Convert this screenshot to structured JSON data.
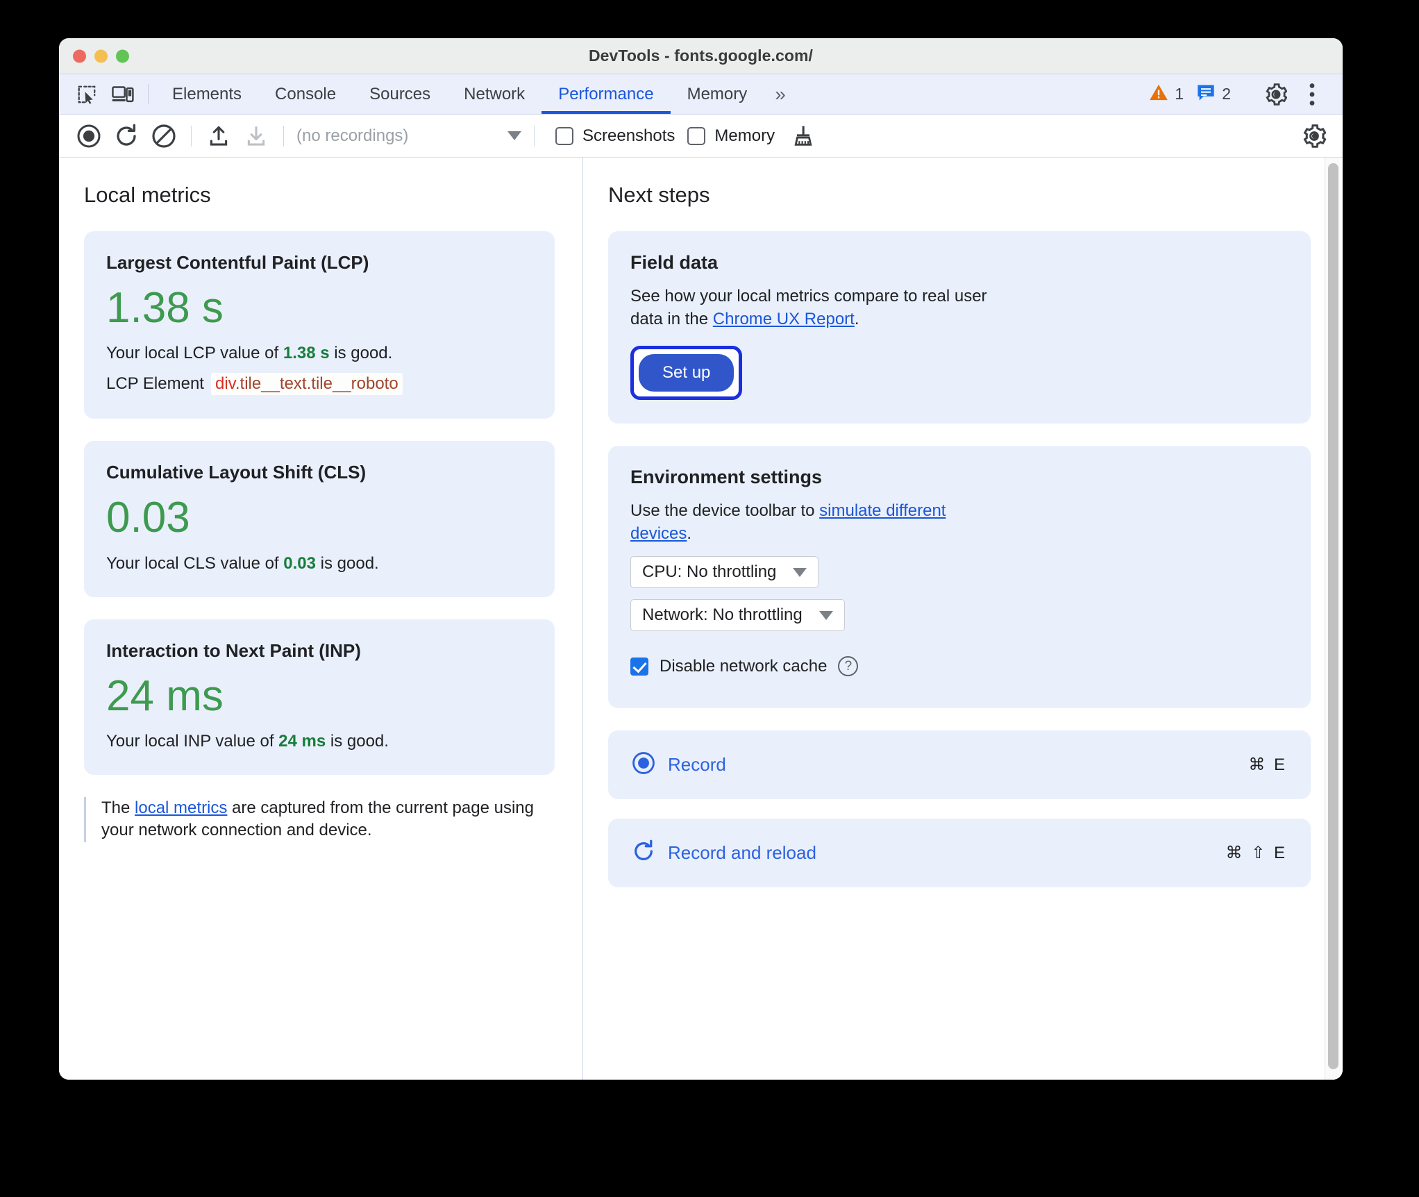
{
  "window": {
    "title": "DevTools - fonts.google.com/",
    "traffic_lights": [
      "close",
      "minimize",
      "maximize"
    ]
  },
  "tabbar": {
    "icons": [
      {
        "name": "inspect-element-icon"
      },
      {
        "name": "device-toolbar-icon"
      }
    ],
    "tabs": [
      {
        "label": "Elements",
        "active": false
      },
      {
        "label": "Console",
        "active": false
      },
      {
        "label": "Sources",
        "active": false
      },
      {
        "label": "Network",
        "active": false
      },
      {
        "label": "Performance",
        "active": true
      },
      {
        "label": "Memory",
        "active": false
      }
    ],
    "more_label": "»",
    "warning_count": "1",
    "info_count": "2",
    "settings_icon": "gear-icon",
    "more_options_icon": "kebab-menu-icon"
  },
  "toolbar": {
    "buttons": [
      {
        "name": "record-button",
        "icon": "record-circle-icon"
      },
      {
        "name": "record-and-reload-button",
        "icon": "reload-icon"
      },
      {
        "name": "clear-button",
        "icon": "no-entry-icon"
      },
      {
        "name": "load-profile-button",
        "icon": "upload-arrow-icon"
      },
      {
        "name": "save-profile-button",
        "icon": "download-arrow-icon"
      }
    ],
    "recordings_placeholder": "(no recordings)",
    "screenshots_label": "Screenshots",
    "screenshots_checked": false,
    "memory_label": "Memory",
    "memory_checked": false,
    "garbage_collect_icon": "broom-icon",
    "capture_settings_icon": "gear-icon"
  },
  "left": {
    "title": "Local metrics",
    "metrics": [
      {
        "name": "Largest Contentful Paint (LCP)",
        "value": "1.38 s",
        "desc_prefix": "Your local LCP value of ",
        "desc_value": "1.38 s",
        "desc_suffix": " is good.",
        "element_label": "LCP Element",
        "element_tag": "div",
        "element_classes": ".tile__text.tile__roboto"
      },
      {
        "name": "Cumulative Layout Shift (CLS)",
        "value": "0.03",
        "desc_prefix": "Your local CLS value of ",
        "desc_value": "0.03",
        "desc_suffix": " is good."
      },
      {
        "name": "Interaction to Next Paint (INP)",
        "value": "24 ms",
        "desc_prefix": "Your local INP value of ",
        "desc_value": "24 ms",
        "desc_suffix": " is good."
      }
    ],
    "note_prefix": "The ",
    "note_link": "local metrics",
    "note_suffix": " are captured from the current page using your network connection and device."
  },
  "right": {
    "title": "Next steps",
    "field_data": {
      "heading": "Field data",
      "body_prefix": "See how your local metrics compare to real user data in the ",
      "body_link": "Chrome UX Report",
      "body_suffix": ".",
      "setup_label": "Set up"
    },
    "environment": {
      "heading": "Environment settings",
      "body_prefix": "Use the device toolbar to ",
      "body_link": "simulate different devices",
      "body_suffix": ".",
      "cpu_throttling": "CPU: No throttling",
      "network_throttling": "Network: No throttling",
      "cache_label": "Disable network cache",
      "cache_checked": true,
      "help_glyph": "?"
    },
    "actions": [
      {
        "label": "Record",
        "shortcut": "⌘ E",
        "icon": "record-circle-icon"
      },
      {
        "label": "Record and reload",
        "shortcut": "⌘ ⇧ E",
        "icon": "reload-icon"
      }
    ]
  },
  "colors": {
    "accent_blue": "#1a56db",
    "good_green": "#3d9a4f",
    "card_bg": "#eaf0fb",
    "warning_orange": "#e8710a",
    "selector_red": "#d93025"
  }
}
